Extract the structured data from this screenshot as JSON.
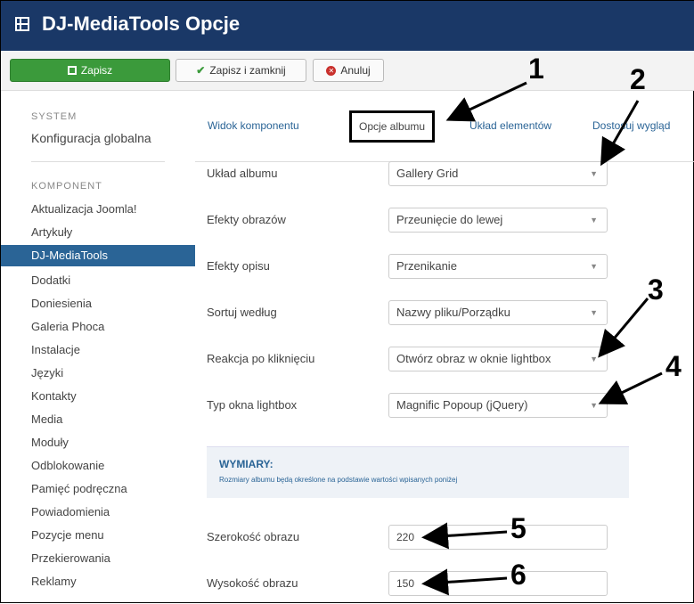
{
  "header": {
    "title": "DJ-MediaTools Opcje"
  },
  "toolbar": {
    "save_label": "Zapisz",
    "save_close_label": "Zapisz i zamknij",
    "cancel_label": "Anuluj"
  },
  "sidebar": {
    "system_label": "SYSTEM",
    "global_config": "Konfiguracja globalna",
    "components_label": "KOMPONENT",
    "items": [
      "Aktualizacja Joomla!",
      "Artykuły",
      "DJ-MediaTools",
      "Dodatki",
      "Doniesienia",
      "Galeria Phoca",
      "Instalacje",
      "Języki",
      "Kontakty",
      "Media",
      "Moduły",
      "Odblokowanie",
      "Pamięć podręczna",
      "Powiadomienia",
      "Pozycje menu",
      "Przekierowania",
      "Reklamy"
    ]
  },
  "tabs": [
    "Widok komponentu",
    "Opcje albumu",
    "Układ elementów",
    "Dostosuj wygląd"
  ],
  "form": {
    "fields": [
      {
        "label": "Układ albumu",
        "value": "Gallery Grid"
      },
      {
        "label": "Efekty obrazów",
        "value": "Przeunięcie do lewej"
      },
      {
        "label": "Efekty opisu",
        "value": "Przenikanie"
      },
      {
        "label": "Sortuj według",
        "value": "Nazwy pliku/Porządku"
      },
      {
        "label": "Reakcja po kliknięciu",
        "value": "Otwórz obraz w oknie lightbox"
      },
      {
        "label": "Typ okna lightbox",
        "value": "Magnific Popoup (jQuery)"
      }
    ],
    "dimensions_title": "WYMIARY:",
    "dimensions_desc": "Rozmiary albumu będą określone na podstawie wartości wpisanych poniżej",
    "width_label": "Szerokość obrazu",
    "width_value": "220",
    "height_label": "Wysokość obrazu",
    "height_value": "150"
  },
  "annotations": [
    "1",
    "2",
    "3",
    "4",
    "5",
    "6"
  ]
}
